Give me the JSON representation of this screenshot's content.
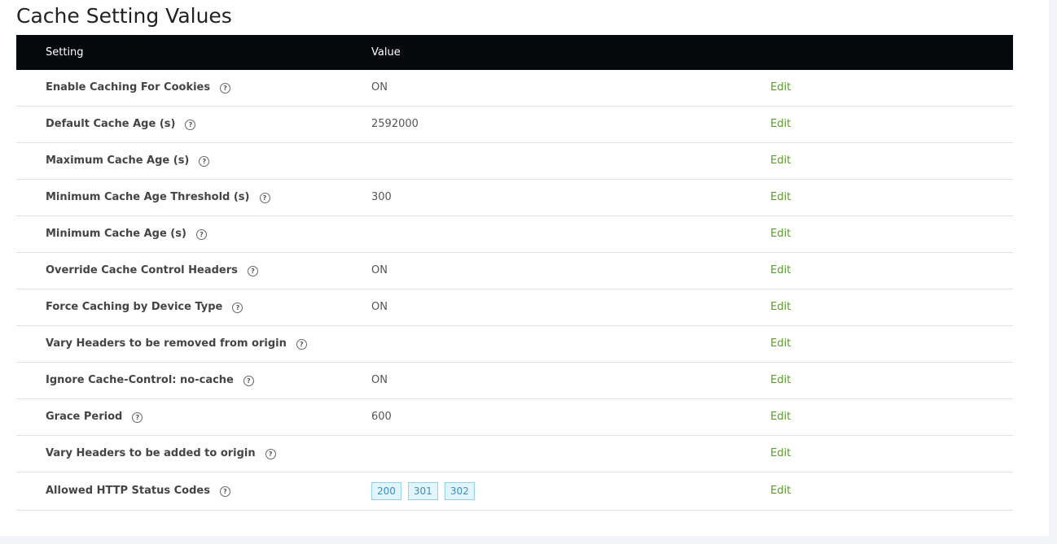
{
  "page": {
    "title": "Cache Setting Values"
  },
  "table": {
    "headers": {
      "setting": "Setting",
      "value": "Value"
    },
    "edit_label": "Edit",
    "rows": [
      {
        "label": "Enable Caching For Cookies",
        "value": "ON"
      },
      {
        "label": "Default Cache Age (s)",
        "value": "2592000"
      },
      {
        "label": "Maximum Cache Age (s)",
        "value": ""
      },
      {
        "label": "Minimum Cache Age Threshold (s)",
        "value": "300"
      },
      {
        "label": "Minimum Cache Age (s)",
        "value": ""
      },
      {
        "label": "Override Cache Control Headers",
        "value": "ON"
      },
      {
        "label": "Force Caching by Device Type",
        "value": "ON"
      },
      {
        "label": "Vary Headers to be removed from origin",
        "value": ""
      },
      {
        "label": "Ignore Cache-Control: no-cache",
        "value": "ON"
      },
      {
        "label": "Grace Period",
        "value": "600"
      },
      {
        "label": "Vary Headers to be added to origin",
        "value": ""
      }
    ],
    "status_codes_row": {
      "label": "Allowed HTTP Status Codes",
      "codes": [
        "200",
        "301",
        "302"
      ]
    }
  },
  "icons": {
    "help": "question-circle-icon"
  },
  "colors": {
    "header_bg": "#05090c",
    "edit_link": "#5a9a2a",
    "code_badge_bg": "#e3f5fc",
    "code_badge_border": "#8fd3ef",
    "page_bg": "#f2f4f7"
  }
}
